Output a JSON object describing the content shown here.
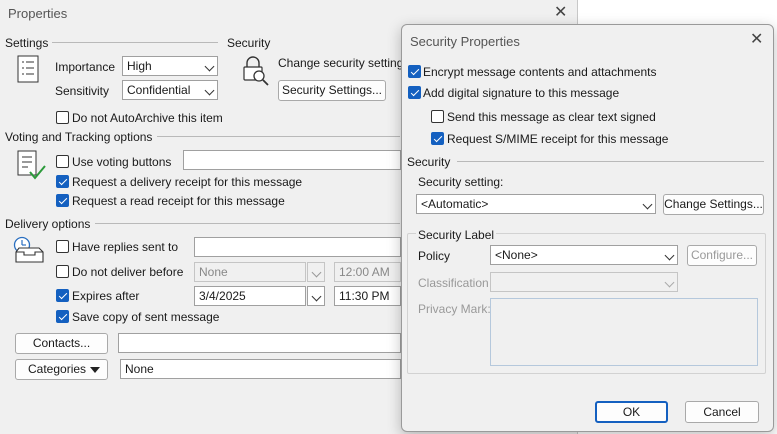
{
  "properties": {
    "title": "Properties",
    "settings": {
      "header": "Settings",
      "importance_label": "Importance",
      "importance_value": "High",
      "sensitivity_label": "Sensitivity",
      "sensitivity_value": "Confidential",
      "autoarchive_label": "Do not AutoArchive this item",
      "autoarchive_checked": false
    },
    "security": {
      "header": "Security",
      "change_label": "Change security settings",
      "button_label": "Security Settings..."
    },
    "voting": {
      "header": "Voting and Tracking options",
      "use_voting_label": "Use voting buttons",
      "use_voting_checked": false,
      "voting_value": "",
      "delivery_receipt_label": "Request a delivery receipt for this message",
      "delivery_receipt_checked": true,
      "read_receipt_label": "Request a read receipt for this message",
      "read_receipt_checked": true
    },
    "delivery": {
      "header": "Delivery options",
      "replies_label": "Have replies sent to",
      "replies_checked": false,
      "replies_value": "",
      "not_before_label": "Do not deliver before",
      "not_before_checked": false,
      "not_before_date": "None",
      "not_before_time": "12:00 AM",
      "expires_label": "Expires after",
      "expires_checked": true,
      "expires_date": "3/4/2025",
      "expires_time": "11:30 PM",
      "save_copy_label": "Save copy of sent message",
      "save_copy_checked": true
    },
    "contacts_button": "Contacts...",
    "contacts_value": "",
    "categories_button": "Categories",
    "categories_value": "None"
  },
  "security_dialog": {
    "title": "Security Properties",
    "encrypt_label": "Encrypt message contents and attachments",
    "encrypt_checked": true,
    "signature_label": "Add digital signature to this message",
    "signature_checked": true,
    "clear_text_label": "Send this message as clear text signed",
    "clear_text_checked": false,
    "smime_label": "Request S/MIME receipt for this message",
    "smime_checked": true,
    "security_header": "Security",
    "security_setting_label": "Security setting:",
    "security_setting_value": "<Automatic>",
    "change_settings_button": "Change Settings...",
    "label_group_header": "Security Label",
    "policy_label": "Policy",
    "policy_value": "<None>",
    "configure_button": "Configure...",
    "classification_label": "Classification",
    "classification_value": "",
    "privacy_mark_label": "Privacy Mark:",
    "privacy_mark_value": "",
    "ok_button": "OK",
    "cancel_button": "Cancel"
  },
  "colors": {
    "accent": "#1460c0",
    "window_bg": "#f0f0f0"
  }
}
